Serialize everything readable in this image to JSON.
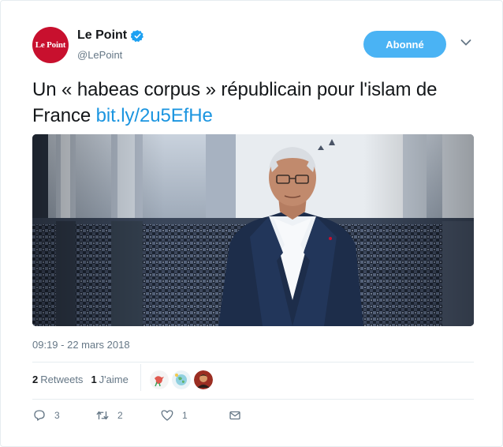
{
  "account": {
    "avatar_text": "Le Point",
    "display_name": "Le Point",
    "handle": "@LePoint",
    "verified_icon": "verified-badge-icon",
    "follow_label": "Abonné"
  },
  "tweet": {
    "text": "Un « habeas corpus » républicain pour l'islam de France ",
    "link": "bit.ly/2u5EfHe",
    "timestamp": "09:19 - 22 mars 2018"
  },
  "stats": {
    "retweets_count": "2",
    "retweets_label": "Retweets",
    "likes_count": "1",
    "likes_label": "J'aime"
  },
  "actions": {
    "reply_count": "3",
    "retweet_count": "2",
    "like_count": "1"
  },
  "colors": {
    "accent": "#1b95e0",
    "follow_bg": "#4ab3f4",
    "brand_red": "#c8102e",
    "muted": "#657786"
  }
}
